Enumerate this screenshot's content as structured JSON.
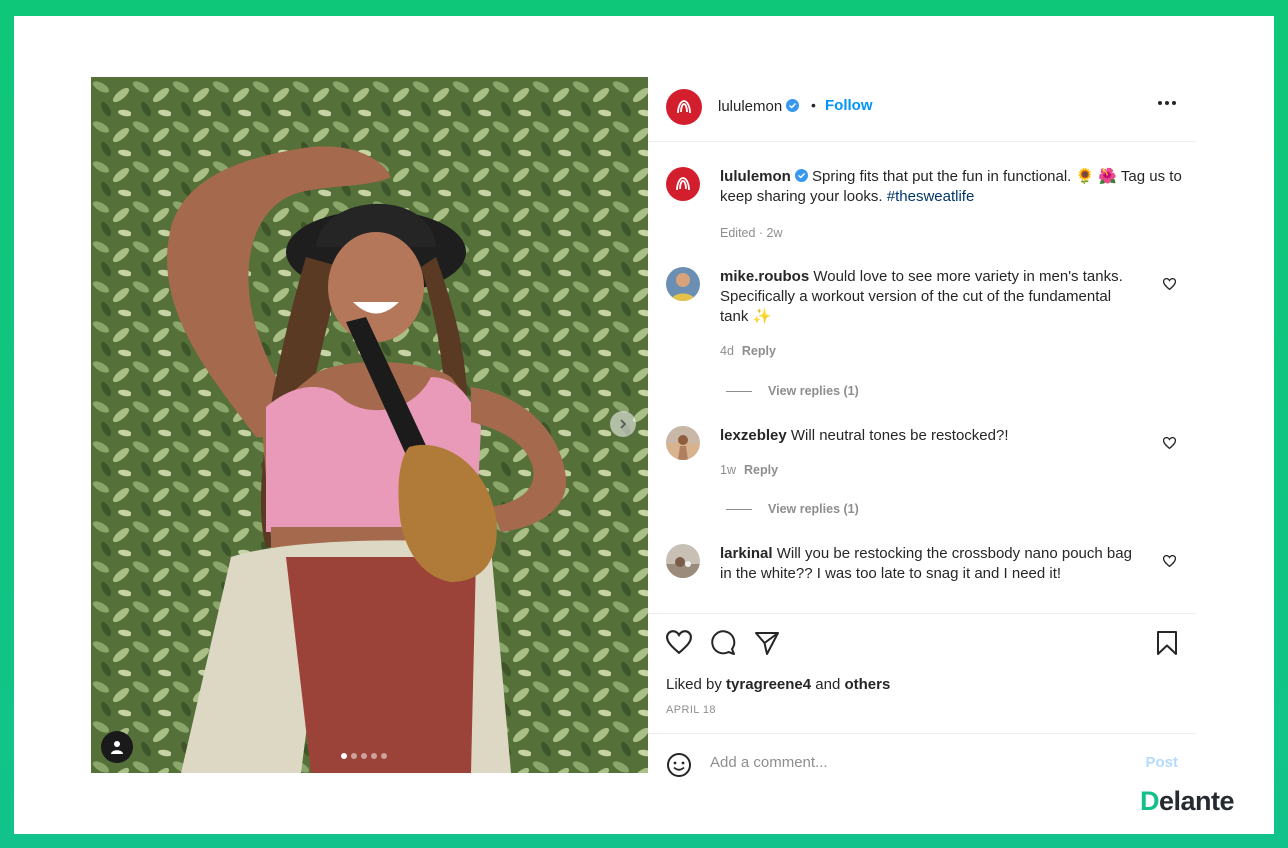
{
  "post": {
    "username": "lululemon",
    "separator": "•",
    "follow_label": "Follow",
    "caption": {
      "username": "lululemon",
      "text": "Spring fits that put the fun in functional. 🌻 🌺 Tag us to keep sharing your looks.",
      "hashtag": "#thesweatlife",
      "meta": "Edited · 2w"
    },
    "comments": [
      {
        "username": "mike.roubos",
        "text": "Would love to see more variety in men's tanks. Specifically a workout version of the cut of the fundamental tank ✨",
        "age": "4d",
        "reply_label": "Reply",
        "view_replies": "View replies (1)"
      },
      {
        "username": "lexzebley",
        "text": "Will neutral tones be restocked?!",
        "age": "1w",
        "reply_label": "Reply",
        "view_replies": "View replies (1)"
      },
      {
        "username": "larkinal",
        "text": "Will you be restocking the crossbody nano pouch bag in the white?? I was too late to snag it and I need it!"
      }
    ],
    "likes": {
      "prefix": "Liked by",
      "user": "tyragreene4",
      "connector": "and",
      "others": "others"
    },
    "date": "APRIL 18",
    "add_comment_placeholder": "Add a comment...",
    "post_label": "Post",
    "carousel": {
      "slides": 5,
      "active_slide": 1
    }
  },
  "brand": {
    "name_first": "D",
    "name_rest": "elante"
  },
  "colors": {
    "frame": "#0fc778",
    "follow": "#0095f6",
    "logo_red": "#d31f2d",
    "hashtag": "#00376b",
    "post_disabled": "#b3dbff"
  },
  "icons": [
    "heart-icon",
    "comment-icon",
    "share-icon",
    "bookmark-icon",
    "emoji-icon",
    "more-icon",
    "verified-icon",
    "tag-user-icon",
    "next-arrow-icon"
  ]
}
